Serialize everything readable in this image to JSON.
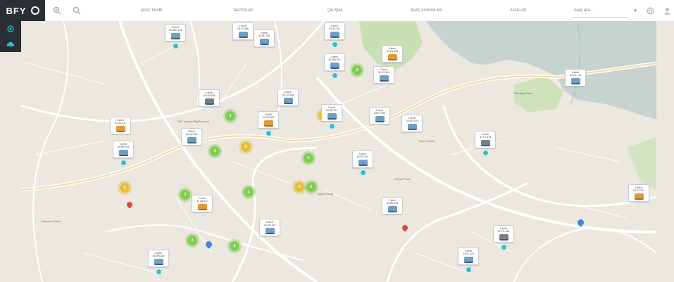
{
  "topbar": {
    "brand": "BFY",
    "tabs": [
      "ARAÇ TAKİBİ",
      "RAPORLAR",
      "ÇALIŞMA",
      "ARAÇ KONUMLARI",
      "AYARLAR"
    ],
    "search_placeholder": "Araç ara...",
    "caret": "▾"
  },
  "markers": [
    {
      "name": "marker-1",
      "label1": "8 km/h",
      "label2": "34 ABC 123",
      "veh": "car"
    },
    {
      "name": "marker-2",
      "label1": "1 km/h",
      "label2": "34 XY 456",
      "veh": "car"
    },
    {
      "name": "marker-3",
      "label1": "2 km/h",
      "label2": "34 DF 789",
      "veh": "car"
    },
    {
      "name": "marker-4",
      "label1": "3 km/h",
      "label2": "34 KL 101",
      "veh": "car"
    },
    {
      "name": "marker-5",
      "label1": "0 km/h",
      "label2": "34 MN 202",
      "veh": "car"
    },
    {
      "name": "marker-6",
      "label1": "5 km/h",
      "label2": "34 PR 303",
      "veh": "bus"
    },
    {
      "name": "marker-7",
      "label1": "7 km/h",
      "label2": "34 ST 404",
      "veh": "car"
    },
    {
      "name": "marker-8",
      "label1": "4 km/h",
      "label2": "34 UV 505",
      "veh": "truck"
    },
    {
      "name": "marker-9",
      "label1": "6 km/h",
      "label2": "34 YZ 606",
      "veh": "car"
    },
    {
      "name": "marker-10",
      "label1": "0 km/h",
      "label2": "34 AB 707",
      "veh": "car"
    },
    {
      "name": "marker-11",
      "label1": "9 km/h",
      "label2": "34 CD 808",
      "veh": "bus"
    },
    {
      "name": "marker-12",
      "label1": "2 km/h",
      "label2": "34 EF 909",
      "veh": "car"
    },
    {
      "name": "marker-13",
      "label1": "1 km/h",
      "label2": "34 GH 110",
      "veh": "car"
    },
    {
      "name": "marker-14",
      "label1": "3 km/h",
      "label2": "34 JK 211",
      "veh": "bus"
    },
    {
      "name": "marker-15",
      "label1": "8 km/h",
      "label2": "34 LM 312",
      "veh": "car"
    },
    {
      "name": "marker-16",
      "label1": "0 km/h",
      "label2": "34 NP 413",
      "veh": "car"
    },
    {
      "name": "marker-17",
      "label1": "5 km/h",
      "label2": "34 RS 514",
      "veh": "car"
    },
    {
      "name": "marker-18",
      "label1": "4 km/h",
      "label2": "34 TU 615",
      "veh": "truck"
    },
    {
      "name": "marker-19",
      "label1": "6 km/h",
      "label2": "34 VY 716",
      "veh": "car"
    },
    {
      "name": "marker-20",
      "label1": "2 km/h",
      "label2": "34 ZA 817",
      "veh": "bus"
    },
    {
      "name": "marker-21",
      "label1": "7 km/h",
      "label2": "34 BC 918",
      "veh": "car"
    },
    {
      "name": "marker-22",
      "label1": "1 km/h",
      "label2": "34 DE 119",
      "veh": "car"
    },
    {
      "name": "marker-23",
      "label1": "3 km/h",
      "label2": "34 FG 220",
      "veh": "car"
    },
    {
      "name": "marker-24",
      "label1": "0 km/h",
      "label2": "34 HJ 321",
      "veh": "bus"
    },
    {
      "name": "marker-25",
      "label1": "9 km/h",
      "label2": "34 KL 422",
      "veh": "car"
    },
    {
      "name": "marker-26",
      "label1": "4 km/h",
      "label2": "34 MN 523",
      "veh": "car"
    }
  ],
  "clusters": [
    {
      "name": "cluster-1",
      "count": "3",
      "color": "green"
    },
    {
      "name": "cluster-2",
      "count": "2",
      "color": "green"
    },
    {
      "name": "cluster-3",
      "count": "4",
      "color": "yellow"
    },
    {
      "name": "cluster-4",
      "count": "2",
      "color": "green"
    },
    {
      "name": "cluster-5",
      "count": "5",
      "color": "yellow"
    },
    {
      "name": "cluster-6",
      "count": "3",
      "color": "green"
    },
    {
      "name": "cluster-7",
      "count": "2",
      "color": "green"
    },
    {
      "name": "cluster-8",
      "count": "6",
      "color": "yellow"
    },
    {
      "name": "cluster-9",
      "count": "3",
      "color": "green"
    },
    {
      "name": "cluster-10",
      "count": "2",
      "color": "green"
    },
    {
      "name": "cluster-11",
      "count": "4",
      "color": "yellow"
    },
    {
      "name": "cluster-12",
      "count": "2",
      "color": "green"
    },
    {
      "name": "cluster-13",
      "count": "3",
      "color": "green"
    },
    {
      "name": "cluster-14",
      "count": "2",
      "color": "green"
    }
  ],
  "pois": [
    "Sivil Toplum Bilgi Merkezi",
    "Dünya Parkı",
    "Sağlık Ocağı",
    "Belediye Parkı",
    "Spor Kulübü",
    "Meydan Camii"
  ]
}
